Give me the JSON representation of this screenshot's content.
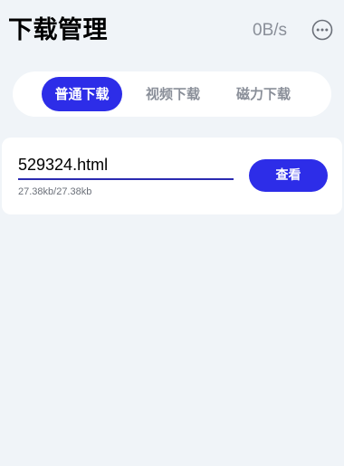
{
  "header": {
    "title": "下载管理",
    "speed": "0B/s",
    "more_icon": "more-horizontal-circle-icon"
  },
  "tabs": [
    {
      "label": "普通下载",
      "active": true
    },
    {
      "label": "视频下载",
      "active": false
    },
    {
      "label": "磁力下载",
      "active": false
    }
  ],
  "downloads": [
    {
      "filename": "529324.html",
      "size": "27.38kb/27.38kb",
      "progress": 1.0,
      "action_label": "查看"
    }
  ],
  "colors": {
    "accent": "#2d2de8",
    "background": "#f0f4f8",
    "muted_text": "#8a8f99"
  }
}
